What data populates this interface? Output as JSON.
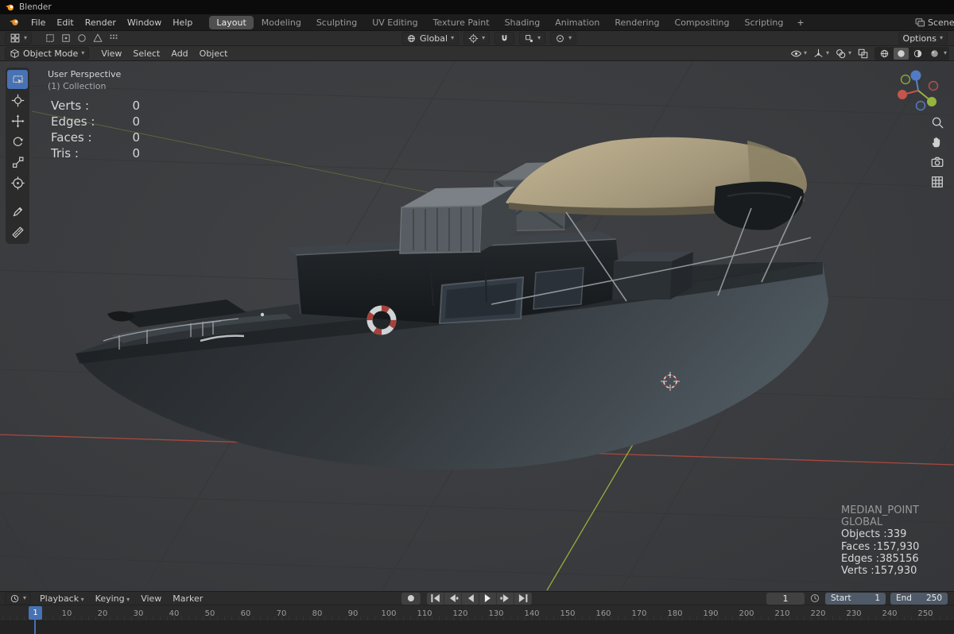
{
  "titlebar": {
    "title": "Blender"
  },
  "topbar": {
    "menus": [
      "File",
      "Edit",
      "Render",
      "Window",
      "Help"
    ],
    "workspaces": [
      "Layout",
      "Modeling",
      "Sculpting",
      "UV Editing",
      "Texture Paint",
      "Shading",
      "Animation",
      "Rendering",
      "Compositing",
      "Scripting"
    ],
    "active_workspace": "Layout",
    "add_workspace": "+",
    "scene": "Scene"
  },
  "tool_settings": {
    "orientation": "Global",
    "options": "Options"
  },
  "viewport_header": {
    "mode": "Object Mode",
    "menus": [
      "View",
      "Select",
      "Add",
      "Object"
    ]
  },
  "viewport": {
    "view_label": "User Perspective",
    "collection_label": "(1) Collection",
    "stats": [
      {
        "label": "Verts :",
        "value": "0"
      },
      {
        "label": "Edges :",
        "value": "0"
      },
      {
        "label": "Faces :",
        "value": "0"
      },
      {
        "label": "Tris :",
        "value": "0"
      }
    ],
    "info_lines": [
      "MEDIAN_POINT",
      "GLOBAL",
      "Objects :339",
      "Faces :157,930",
      "Edges :385156",
      "Verts :157,930"
    ]
  },
  "timeline": {
    "menus": [
      "Playback",
      "Keying",
      "View",
      "Marker"
    ],
    "current_frame": "1",
    "playhead_frame": "1",
    "start_label": "Start",
    "start_value": "1",
    "end_label": "End",
    "end_value": "250",
    "ticks": [
      "10",
      "20",
      "30",
      "40",
      "50",
      "60",
      "70",
      "80",
      "90",
      "100",
      "110",
      "120",
      "130",
      "140",
      "150",
      "160",
      "170",
      "180",
      "190",
      "200",
      "210",
      "220",
      "230",
      "240",
      "250"
    ]
  },
  "icons": {
    "caret": "▾"
  },
  "colors": {
    "accent": "#4772b3",
    "axis_x": "#c5483e",
    "axis_y": "#9ab33b",
    "viewport_bg": "#3b3d40",
    "canopy": "#b3a685"
  }
}
